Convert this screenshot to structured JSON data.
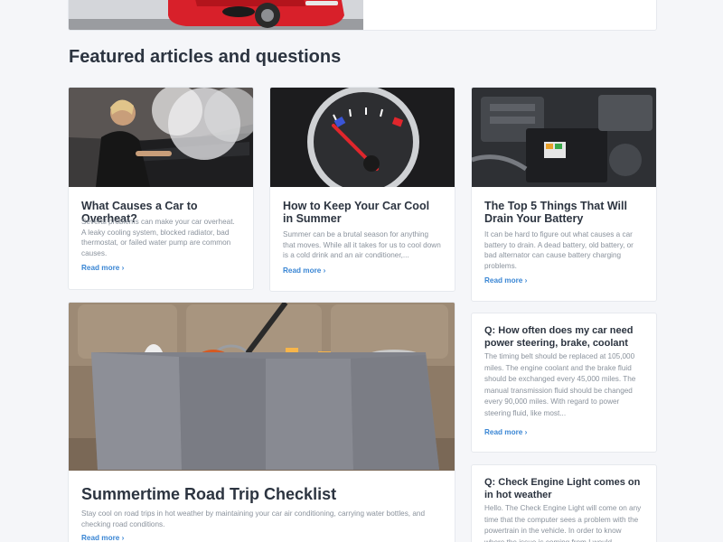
{
  "section": {
    "title": "Featured articles and questions"
  },
  "articles": [
    {
      "title": "What Causes a Car to Overheat?",
      "description": "Several problems can make your car overheat. A leaky cooling system, blocked radiator, bad thermostat, or failed water pump are common causes.",
      "read_more": "Read more ›"
    },
    {
      "title": "How to Keep Your Car Cool in Summer",
      "description": "Summer can be a brutal season for anything that moves. While all it takes for us to cool down is a cold drink and an air conditioner,...",
      "read_more": "Read more ›"
    },
    {
      "title": "The Top 5 Things That Will Drain Your Battery",
      "description": "It can be hard to figure out what causes a car battery to drain. A dead battery, old battery, or bad alternator can cause battery charging problems.",
      "read_more": "Read more ›"
    }
  ],
  "feature": {
    "title": "Summertime Road Trip Checklist",
    "description": "Stay cool on road trips in hot weather by maintaining your car air conditioning, carrying water bottles, and checking road conditions.",
    "read_more": "Read more ›"
  },
  "questions": [
    {
      "title": "Q: How often does my car need power steering, brake, coolant",
      "description": "The timing belt should be replaced at 105,000 miles. The engine coolant and the brake fluid should be exchanged every 45,000 miles. The manual transmission fluid should be changed every 90,000 miles. With regard to power steering fluid, like most...",
      "read_more": "Read more ›"
    },
    {
      "title": "Q: Check Engine Light comes on in hot weather",
      "description": "Hello. The Check Engine Light will come on any time that the computer sees a problem with the powertrain in the vehicle. In order to know where the issue is coming from I would"
    }
  ]
}
